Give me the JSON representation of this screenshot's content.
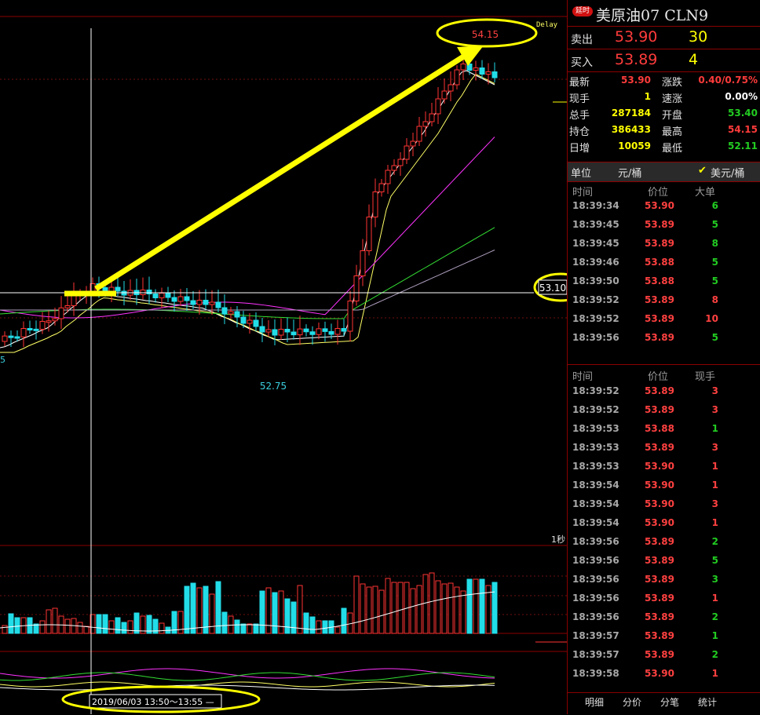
{
  "chart_data": {
    "type": "candlestick",
    "delay_label": "Delay",
    "high_label": "54.15",
    "low_label": "52.75",
    "left_edge_label": "5",
    "crosshair_price": "53.10",
    "interval_label": "1秒",
    "time_range": "2019/06/03 13:50～13:55 —"
  },
  "panel": {
    "badge": "延时",
    "title": "美原油07  CLN9",
    "ask": {
      "label": "卖出",
      "price": "53.90",
      "volume": "30"
    },
    "bid": {
      "label": "买入",
      "price": "53.89",
      "volume": "4"
    },
    "stats": [
      {
        "label": "最新",
        "value": "53.90",
        "color": "#ff3b3b"
      },
      {
        "label": "涨跌",
        "value": "0.40/0.75%",
        "color": "#ff3b3b"
      },
      {
        "label": "现手",
        "value": "1",
        "color": "#ffff00"
      },
      {
        "label": "速涨",
        "value": "0.00%",
        "color": "#ffffff"
      },
      {
        "label": "总手",
        "value": "287184",
        "color": "#ffff00"
      },
      {
        "label": "开盘",
        "value": "53.40",
        "color": "#22cc22"
      },
      {
        "label": "持仓",
        "value": "386433",
        "color": "#ffff00"
      },
      {
        "label": "最高",
        "value": "54.15",
        "color": "#ff3b3b"
      },
      {
        "label": "日增",
        "value": "10059",
        "color": "#ffff00"
      },
      {
        "label": "最低",
        "value": "52.11",
        "color": "#22cc22"
      }
    ],
    "unit": {
      "label": "单位",
      "value": "元/桶",
      "check": "✔",
      "option": "美元/桶"
    },
    "big_orders": {
      "headers": [
        "时间",
        "价位",
        "大单"
      ],
      "rows": [
        {
          "time": "18:39:34",
          "price": "53.90",
          "vol": "6",
          "up": false
        },
        {
          "time": "18:39:45",
          "price": "53.89",
          "vol": "5",
          "up": false
        },
        {
          "time": "18:39:45",
          "price": "53.89",
          "vol": "8",
          "up": false
        },
        {
          "time": "18:39:46",
          "price": "53.88",
          "vol": "5",
          "up": false
        },
        {
          "time": "18:39:50",
          "price": "53.88",
          "vol": "5",
          "up": false
        },
        {
          "time": "18:39:52",
          "price": "53.89",
          "vol": "8",
          "up": true
        },
        {
          "time": "18:39:52",
          "price": "53.89",
          "vol": "10",
          "up": true
        },
        {
          "time": "18:39:56",
          "price": "53.89",
          "vol": "5",
          "up": false
        }
      ]
    },
    "ticks": {
      "headers": [
        "时间",
        "价位",
        "现手"
      ],
      "rows": [
        {
          "time": "18:39:52",
          "price": "53.89",
          "vol": "3",
          "up": true
        },
        {
          "time": "18:39:52",
          "price": "53.89",
          "vol": "3",
          "up": true
        },
        {
          "time": "18:39:53",
          "price": "53.88",
          "vol": "1",
          "up": false
        },
        {
          "time": "18:39:53",
          "price": "53.89",
          "vol": "3",
          "up": true
        },
        {
          "time": "18:39:53",
          "price": "53.90",
          "vol": "1",
          "up": true
        },
        {
          "time": "18:39:54",
          "price": "53.90",
          "vol": "1",
          "up": true
        },
        {
          "time": "18:39:54",
          "price": "53.90",
          "vol": "3",
          "up": true
        },
        {
          "time": "18:39:54",
          "price": "53.90",
          "vol": "1",
          "up": true
        },
        {
          "time": "18:39:56",
          "price": "53.89",
          "vol": "2",
          "up": false
        },
        {
          "time": "18:39:56",
          "price": "53.89",
          "vol": "5",
          "up": false
        },
        {
          "time": "18:39:56",
          "price": "53.89",
          "vol": "3",
          "up": false
        },
        {
          "time": "18:39:56",
          "price": "53.89",
          "vol": "1",
          "up": true
        },
        {
          "time": "18:39:56",
          "price": "53.89",
          "vol": "2",
          "up": false
        },
        {
          "time": "18:39:57",
          "price": "53.89",
          "vol": "1",
          "up": false
        },
        {
          "time": "18:39:57",
          "price": "53.89",
          "vol": "2",
          "up": false
        },
        {
          "time": "18:39:58",
          "price": "53.90",
          "vol": "1",
          "up": true
        }
      ]
    },
    "tabs": [
      "明细",
      "分价",
      "分笔",
      "统计"
    ]
  }
}
